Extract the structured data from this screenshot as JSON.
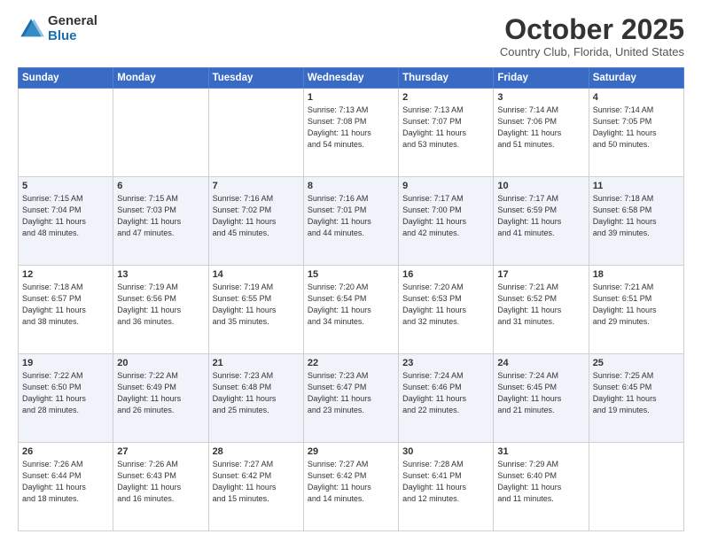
{
  "logo": {
    "general": "General",
    "blue": "Blue"
  },
  "header": {
    "month": "October 2025",
    "location": "Country Club, Florida, United States"
  },
  "weekdays": [
    "Sunday",
    "Monday",
    "Tuesday",
    "Wednesday",
    "Thursday",
    "Friday",
    "Saturday"
  ],
  "weeks": [
    [
      {
        "day": "",
        "info": ""
      },
      {
        "day": "",
        "info": ""
      },
      {
        "day": "",
        "info": ""
      },
      {
        "day": "1",
        "info": "Sunrise: 7:13 AM\nSunset: 7:08 PM\nDaylight: 11 hours\nand 54 minutes."
      },
      {
        "day": "2",
        "info": "Sunrise: 7:13 AM\nSunset: 7:07 PM\nDaylight: 11 hours\nand 53 minutes."
      },
      {
        "day": "3",
        "info": "Sunrise: 7:14 AM\nSunset: 7:06 PM\nDaylight: 11 hours\nand 51 minutes."
      },
      {
        "day": "4",
        "info": "Sunrise: 7:14 AM\nSunset: 7:05 PM\nDaylight: 11 hours\nand 50 minutes."
      }
    ],
    [
      {
        "day": "5",
        "info": "Sunrise: 7:15 AM\nSunset: 7:04 PM\nDaylight: 11 hours\nand 48 minutes."
      },
      {
        "day": "6",
        "info": "Sunrise: 7:15 AM\nSunset: 7:03 PM\nDaylight: 11 hours\nand 47 minutes."
      },
      {
        "day": "7",
        "info": "Sunrise: 7:16 AM\nSunset: 7:02 PM\nDaylight: 11 hours\nand 45 minutes."
      },
      {
        "day": "8",
        "info": "Sunrise: 7:16 AM\nSunset: 7:01 PM\nDaylight: 11 hours\nand 44 minutes."
      },
      {
        "day": "9",
        "info": "Sunrise: 7:17 AM\nSunset: 7:00 PM\nDaylight: 11 hours\nand 42 minutes."
      },
      {
        "day": "10",
        "info": "Sunrise: 7:17 AM\nSunset: 6:59 PM\nDaylight: 11 hours\nand 41 minutes."
      },
      {
        "day": "11",
        "info": "Sunrise: 7:18 AM\nSunset: 6:58 PM\nDaylight: 11 hours\nand 39 minutes."
      }
    ],
    [
      {
        "day": "12",
        "info": "Sunrise: 7:18 AM\nSunset: 6:57 PM\nDaylight: 11 hours\nand 38 minutes."
      },
      {
        "day": "13",
        "info": "Sunrise: 7:19 AM\nSunset: 6:56 PM\nDaylight: 11 hours\nand 36 minutes."
      },
      {
        "day": "14",
        "info": "Sunrise: 7:19 AM\nSunset: 6:55 PM\nDaylight: 11 hours\nand 35 minutes."
      },
      {
        "day": "15",
        "info": "Sunrise: 7:20 AM\nSunset: 6:54 PM\nDaylight: 11 hours\nand 34 minutes."
      },
      {
        "day": "16",
        "info": "Sunrise: 7:20 AM\nSunset: 6:53 PM\nDaylight: 11 hours\nand 32 minutes."
      },
      {
        "day": "17",
        "info": "Sunrise: 7:21 AM\nSunset: 6:52 PM\nDaylight: 11 hours\nand 31 minutes."
      },
      {
        "day": "18",
        "info": "Sunrise: 7:21 AM\nSunset: 6:51 PM\nDaylight: 11 hours\nand 29 minutes."
      }
    ],
    [
      {
        "day": "19",
        "info": "Sunrise: 7:22 AM\nSunset: 6:50 PM\nDaylight: 11 hours\nand 28 minutes."
      },
      {
        "day": "20",
        "info": "Sunrise: 7:22 AM\nSunset: 6:49 PM\nDaylight: 11 hours\nand 26 minutes."
      },
      {
        "day": "21",
        "info": "Sunrise: 7:23 AM\nSunset: 6:48 PM\nDaylight: 11 hours\nand 25 minutes."
      },
      {
        "day": "22",
        "info": "Sunrise: 7:23 AM\nSunset: 6:47 PM\nDaylight: 11 hours\nand 23 minutes."
      },
      {
        "day": "23",
        "info": "Sunrise: 7:24 AM\nSunset: 6:46 PM\nDaylight: 11 hours\nand 22 minutes."
      },
      {
        "day": "24",
        "info": "Sunrise: 7:24 AM\nSunset: 6:45 PM\nDaylight: 11 hours\nand 21 minutes."
      },
      {
        "day": "25",
        "info": "Sunrise: 7:25 AM\nSunset: 6:45 PM\nDaylight: 11 hours\nand 19 minutes."
      }
    ],
    [
      {
        "day": "26",
        "info": "Sunrise: 7:26 AM\nSunset: 6:44 PM\nDaylight: 11 hours\nand 18 minutes."
      },
      {
        "day": "27",
        "info": "Sunrise: 7:26 AM\nSunset: 6:43 PM\nDaylight: 11 hours\nand 16 minutes."
      },
      {
        "day": "28",
        "info": "Sunrise: 7:27 AM\nSunset: 6:42 PM\nDaylight: 11 hours\nand 15 minutes."
      },
      {
        "day": "29",
        "info": "Sunrise: 7:27 AM\nSunset: 6:42 PM\nDaylight: 11 hours\nand 14 minutes."
      },
      {
        "day": "30",
        "info": "Sunrise: 7:28 AM\nSunset: 6:41 PM\nDaylight: 11 hours\nand 12 minutes."
      },
      {
        "day": "31",
        "info": "Sunrise: 7:29 AM\nSunset: 6:40 PM\nDaylight: 11 hours\nand 11 minutes."
      },
      {
        "day": "",
        "info": ""
      }
    ]
  ]
}
